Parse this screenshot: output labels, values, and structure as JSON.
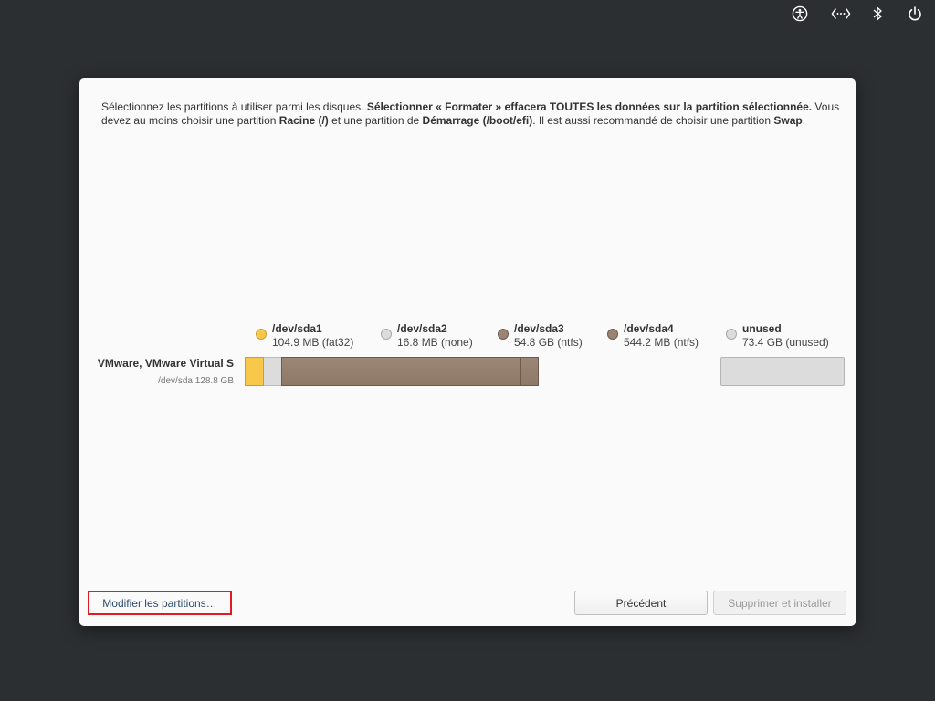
{
  "topbar": {
    "icons": [
      "accessibility-icon",
      "network-icon",
      "bluetooth-icon",
      "power-icon"
    ]
  },
  "intro": {
    "t1": "Sélectionnez les partitions à utiliser parmi les disques. ",
    "b1": "Sélectionner « Formater » effacera TOUTES les données sur la partition sélectionnée.",
    "t2": " Vous devez au moins choisir une partition ",
    "b2": "Racine (/)",
    "t3": " et une partition de ",
    "b3": "Démarrage (/boot/efi)",
    "t4": ". Il est aussi recommandé de choisir une partition ",
    "b4": "Swap",
    "t5": "."
  },
  "disk": {
    "name": "VMware, VMware Virtual S",
    "info": "/dev/sda 128.8 GB"
  },
  "legend": [
    {
      "name": "/dev/sda1",
      "detail": "104.9 MB (fat32)",
      "color": "#f7c84a",
      "border": "#c8a030"
    },
    {
      "name": "/dev/sda2",
      "detail": "16.8 MB (none)",
      "color": "#dcdcdc",
      "border": "#a8a8a8"
    },
    {
      "name": "/dev/sda3",
      "detail": "54.8 GB (ntfs)",
      "color": "#9c8474",
      "border": "#6e5a4c"
    },
    {
      "name": "/dev/sda4",
      "detail": "544.2 MB (ntfs)",
      "color": "#9c8474",
      "border": "#6e5a4c"
    },
    {
      "name": "unused",
      "detail": "73.4 GB (unused)",
      "color": "#dcdcdc",
      "border": "#a8a8a8"
    }
  ],
  "actions": {
    "modify": "Modifier les partitions…",
    "back": "Précédent",
    "install": "Supprimer et installer"
  },
  "colors": {
    "background": "#2c2f32",
    "dialog": "#fafafa",
    "highlight": "#e01b24"
  }
}
